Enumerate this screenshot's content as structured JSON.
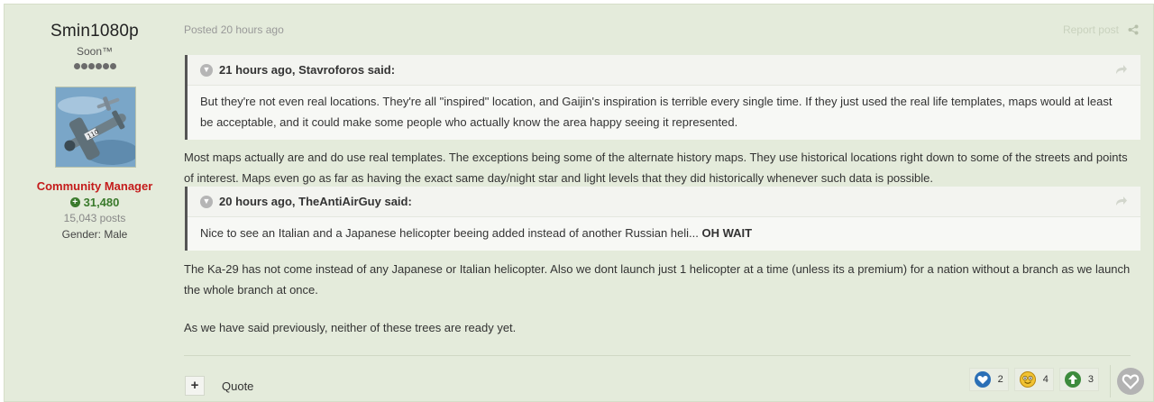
{
  "author": {
    "name": "Smin1080p",
    "title": "Soon™",
    "rank_pips": 6,
    "group": "Community Manager",
    "reputation": "31,480",
    "posts": "15,043 posts",
    "gender": "Gender: Male"
  },
  "post": {
    "posted": "Posted 20 hours ago",
    "report_label": "Report post",
    "quotes": [
      {
        "attribution": "21 hours ago, Stavroforos said:",
        "text": "But they're not even real locations. They're all \"inspired\" location, and Gaijin's inspiration is terrible every single time. If they just used the real life templates, maps would at least be acceptable, and it could make some people who actually know the area happy seeing it represented."
      },
      {
        "attribution": "20 hours ago, TheAntiAirGuy said:",
        "text": "Nice to see an Italian and a Japanese helicopter beeing added instead of another Russian heli... ",
        "emphasis": "OH WAIT"
      }
    ],
    "paragraphs": [
      "Most maps actually are and do use real templates. The exceptions being some of the alternate history maps. They use historical locations right down to some of the streets and points of interest. Maps even go as far as having the exact same day/night star and light levels that they did historically whenever such data is possible.",
      "The Ka-29 has not come instead of any Japanese or Italian helicopter. Also we dont launch just 1 helicopter at a time (unless its a premium) for a nation without a branch as we launch the whole branch at once.",
      "As we have said previously, neither of these trees are ready yet."
    ]
  },
  "actions": {
    "multiquote": "+",
    "quote": "Quote"
  },
  "reactions": [
    {
      "icon": "heart-reaction-icon",
      "count": "2",
      "color": "#2b6fb6"
    },
    {
      "icon": "haha-reaction-icon",
      "count": "4",
      "color": "#e6b422"
    },
    {
      "icon": "upvote-reaction-icon",
      "count": "3",
      "color": "#3d8b3d"
    }
  ],
  "colors": {
    "post_background": "#e4ebdb",
    "group_color": "#c41b1b",
    "reputation_color": "#3a7a2c"
  }
}
